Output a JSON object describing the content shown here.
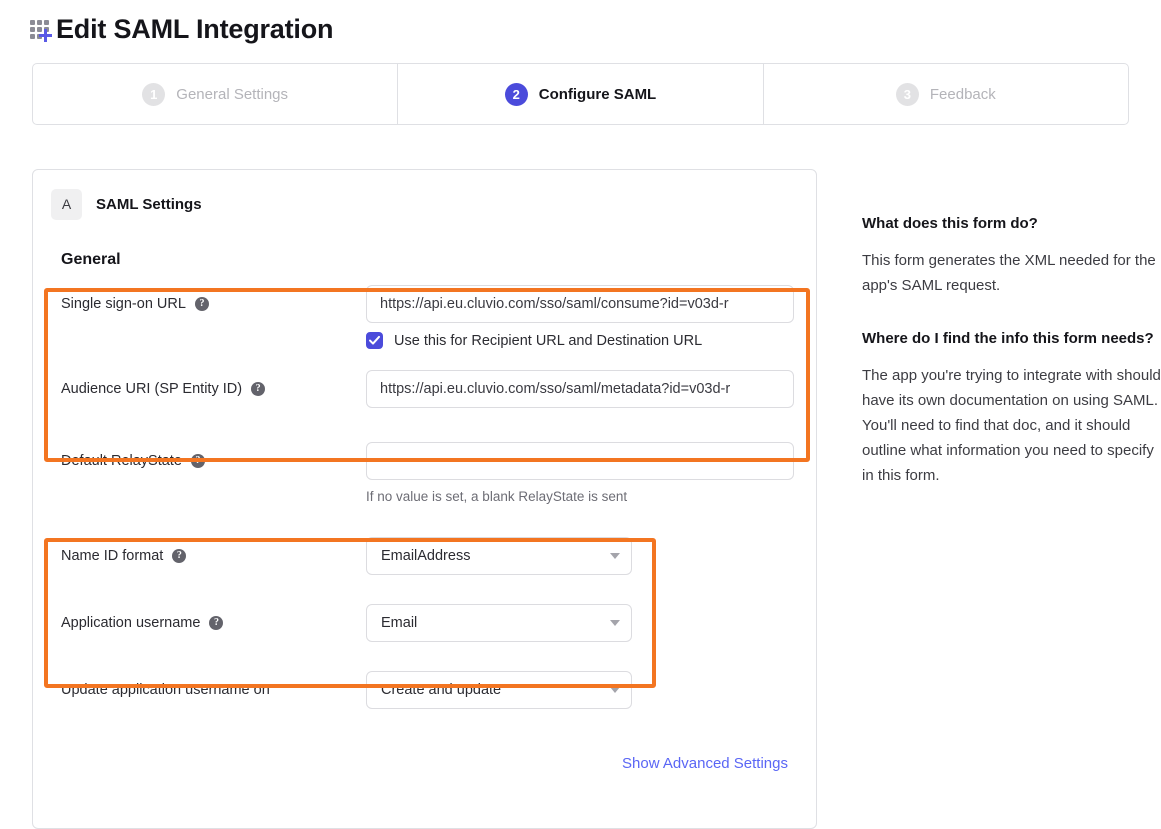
{
  "header": {
    "title": "Edit SAML Integration",
    "icon": "app-grid-plus-icon"
  },
  "stepper": {
    "steps": [
      {
        "number": "1",
        "label": "General Settings",
        "active": false
      },
      {
        "number": "2",
        "label": "Configure SAML",
        "active": true
      },
      {
        "number": "3",
        "label": "Feedback",
        "active": false
      }
    ]
  },
  "form": {
    "section_badge": "A",
    "section_title": "SAML Settings",
    "group_title": "General",
    "fields": {
      "sso_url": {
        "label": "Single sign-on URL",
        "value": "https://api.eu.cluvio.com/sso/saml/consume?id=v03d-r",
        "help": "?"
      },
      "recipient_checkbox": {
        "label": "Use this for Recipient URL and Destination URL",
        "checked": true
      },
      "audience_uri": {
        "label": "Audience URI (SP Entity ID)",
        "value": "https://api.eu.cluvio.com/sso/saml/metadata?id=v03d-r",
        "help": "?"
      },
      "default_relaystate": {
        "label": "Default RelayState",
        "value": "",
        "placeholder": "",
        "hint": "If no value is set, a blank RelayState is sent",
        "help": "?"
      },
      "name_id_format": {
        "label": "Name ID format",
        "value": "EmailAddress",
        "help": "?"
      },
      "application_username": {
        "label": "Application username",
        "value": "Email",
        "help": "?"
      },
      "update_app_username_on": {
        "label": "Update application username on",
        "value": "Create and update"
      }
    },
    "advanced_link": "Show Advanced Settings"
  },
  "side_help": {
    "blocks": [
      {
        "question": "What does this form do?",
        "answer": "This form generates the XML needed for the app's SAML request."
      },
      {
        "question": "Where do I find the info this form needs?",
        "answer": "The app you're trying to integrate with should have its own documentation on using SAML. You'll need to find that doc, and it should outline what information you need to specify in this form."
      }
    ]
  },
  "colors": {
    "accent_blue": "#4b4bdb",
    "link_blue": "#5a66f5",
    "highlight_orange": "#f37521",
    "muted_gray": "#b4b4b9"
  }
}
